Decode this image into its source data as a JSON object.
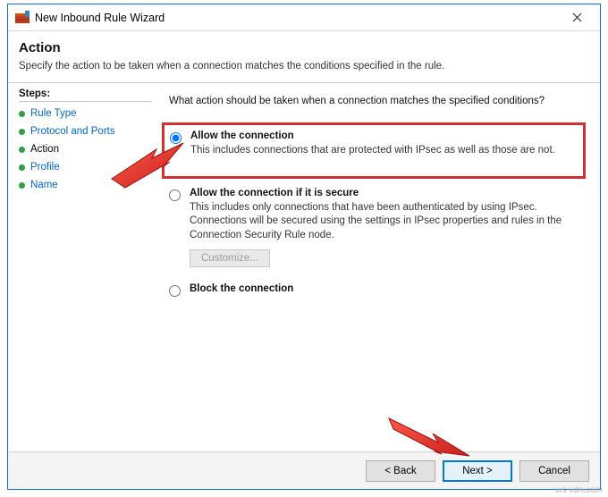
{
  "window": {
    "title": "New Inbound Rule Wizard"
  },
  "header": {
    "heading": "Action",
    "subtitle": "Specify the action to be taken when a connection matches the conditions specified in the rule."
  },
  "steps": {
    "heading": "Steps:",
    "items": [
      {
        "label": "Rule Type",
        "current": false
      },
      {
        "label": "Protocol and Ports",
        "current": false
      },
      {
        "label": "Action",
        "current": true
      },
      {
        "label": "Profile",
        "current": false
      },
      {
        "label": "Name",
        "current": false
      }
    ]
  },
  "main": {
    "question": "What action should be taken when a connection matches the specified conditions?",
    "options": [
      {
        "id": "allow",
        "title": "Allow the connection",
        "desc": "This includes connections that are protected with IPsec as well as those are not.",
        "selected": true,
        "highlighted": true
      },
      {
        "id": "allow-secure",
        "title": "Allow the connection if it is secure",
        "desc": "This includes only connections that have been authenticated by using IPsec.  Connections will be secured using the settings in IPsec properties and rules in the Connection Security Rule node.",
        "selected": false,
        "customize_label": "Customize...",
        "customize_enabled": false
      },
      {
        "id": "block",
        "title": "Block the connection",
        "desc": "",
        "selected": false
      }
    ]
  },
  "footer": {
    "back": "< Back",
    "next": "Next >",
    "cancel": "Cancel"
  },
  "watermark": "ws vdn.com"
}
